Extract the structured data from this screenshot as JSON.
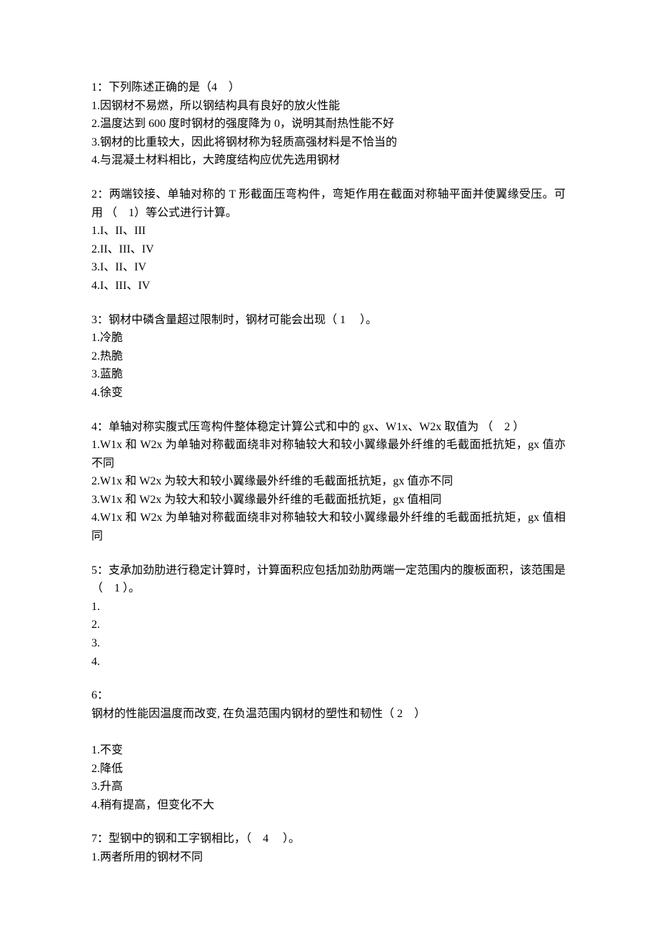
{
  "questions": [
    {
      "stem": "1：下列陈述正确的是（4　）",
      "options": [
        "1.因钢材不易燃，所以钢结构具有良好的放火性能",
        "2.温度达到 600 度时钢材的强度降为 0，说明其耐热性能不好",
        "3.钢材的比重较大，因此将钢材称为轻质高强材料是不恰当的",
        "4.与混凝土材料相比，大跨度结构应优先选用钢材"
      ]
    },
    {
      "stem": "2：两端铰接、单轴对称的 T 形截面压弯构件，弯矩作用在截面对称轴平面并使翼缘受压。可用 （　1）等公式进行计算。",
      "options": [
        "1.I、II、III",
        "2.II、III、IV",
        "3.I、II、IV",
        "4.I、III、IV"
      ]
    },
    {
      "stem": "3：钢材中磷含量超过限制时，钢材可能会出现（ 1　 ）。",
      "options": [
        "1.冷脆",
        "2.热脆",
        "3.蓝脆",
        "4.徐变"
      ]
    },
    {
      "stem": "4：单轴对称实腹式压弯构件整体稳定计算公式和中的 gx、W1x、W2x 取值为 （　2 ）",
      "options": [
        "1.W1x 和 W2x 为单轴对称截面绕非对称轴较大和较小翼缘最外纤维的毛截面抵抗矩，gx 值亦不同",
        "2.W1x 和 W2x 为较大和较小翼缘最外纤维的毛截面抵抗矩，gx 值亦不同",
        "3.W1x 和 W2x 为较大和较小翼缘最外纤维的毛截面抵抗矩，gx 值相同",
        "4.W1x 和 W2x 为单轴对称截面绕非对称轴较大和较小翼缘最外纤维的毛截面抵抗矩，gx 值相同"
      ]
    },
    {
      "stem": "5：支承加劲肋进行稳定计算时，计算面积应包括加劲肋两端一定范围内的腹板面积，该范围是（　1 ）。",
      "options": [
        "1.",
        "2.",
        "3.",
        "4."
      ]
    },
    {
      "stem": "6：\n钢材的性能因温度而改变, 在负温范围内钢材的塑性和韧性（ 2　）",
      "gap_after_stem": true,
      "options": [
        "1.不变",
        "2.降低",
        "3.升高",
        "4.稍有提高，但变化不大"
      ]
    },
    {
      "stem": "7：型钢中的钢和工字钢相比，（　4　 ）。",
      "options": [
        "1.两者所用的钢材不同"
      ]
    }
  ]
}
